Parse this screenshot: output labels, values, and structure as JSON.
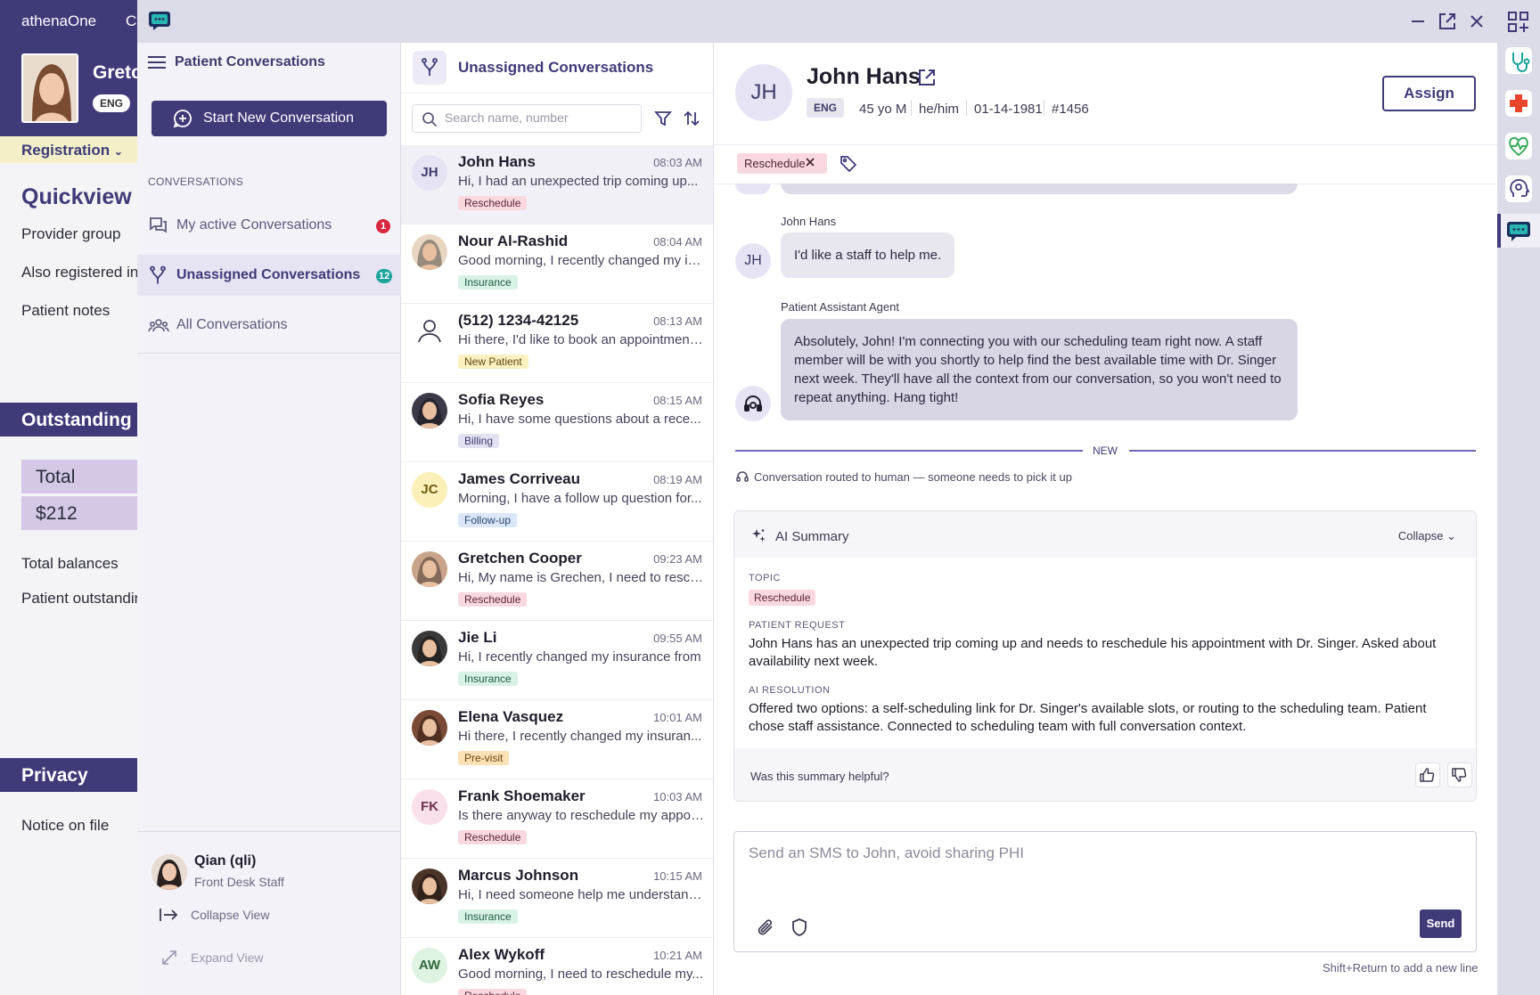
{
  "background": {
    "brand": "athenaOne",
    "tab_fragment": "C",
    "patient_name_fragment": "Gretc",
    "eng_badge": "ENG",
    "registration_label": "Registration",
    "quickview_heading": "Quickview",
    "provider_group": "Provider group",
    "also_registered": "Also registered in",
    "patient_notes": "Patient notes",
    "outstanding_band": "Outstanding B",
    "total_label": "Total",
    "total_value": "$212",
    "total_balances": "Total balances",
    "patient_outstanding": "Patient outstanding",
    "privacy_band": "Privacy",
    "notice_on_file": "Notice on file"
  },
  "nav": {
    "title": "Patient Conversations",
    "start_new": "Start New Conversation",
    "section_label": "CONVERSATIONS",
    "items": [
      {
        "label": "My active Conversations",
        "badge": "1",
        "badge_color": "#d7263d"
      },
      {
        "label": "Unassigned Conversations",
        "badge": "12",
        "badge_color": "#1ba39c"
      },
      {
        "label": "All Conversations",
        "badge": ""
      }
    ],
    "user": {
      "name": "Qian (qli)",
      "role": "Front Desk Staff"
    },
    "collapse_view": "Collapse View",
    "expand_view": "Expand View"
  },
  "list": {
    "title": "Unassigned Conversations",
    "search_placeholder": "Search name, number",
    "conversations": [
      {
        "initials": "JH",
        "name": "John Hans",
        "time": "08:03 AM",
        "preview": "Hi, I had an unexpected trip coming up...",
        "tag": "Reschedule",
        "tag_kind": "reschedule",
        "avatar": "initials",
        "avatar_bg": "#e6e4f4",
        "avatar_fg": "#3d3a6b"
      },
      {
        "initials": "",
        "name": "Nour Al-Rashid",
        "time": "08:04 AM",
        "preview": "Good morning, I recently changed my in...",
        "tag": "Insurance",
        "tag_kind": "insurance",
        "avatar": "photo",
        "avatar_bg": "#e8d6c0"
      },
      {
        "initials": "",
        "name": "(512) 1234-42125",
        "time": "08:13 AM",
        "preview": "Hi there, I'd like to book an appointment...",
        "tag": "New Patient",
        "tag_kind": "newpatient",
        "avatar": "person",
        "avatar_bg": "#ffffff"
      },
      {
        "initials": "",
        "name": "Sofia Reyes",
        "time": "08:15 AM",
        "preview": "Hi, I have some questions about a rece...",
        "tag": "Billing",
        "tag_kind": "billing",
        "avatar": "photo",
        "avatar_bg": "#3c3a48"
      },
      {
        "initials": "JC",
        "name": "James Corriveau",
        "time": "08:19 AM",
        "preview": "Morning, I have a follow up question for...",
        "tag": "Follow-up",
        "tag_kind": "followup",
        "avatar": "initials",
        "avatar_bg": "#fbf0b8",
        "avatar_fg": "#6b5a10"
      },
      {
        "initials": "",
        "name": "Gretchen Cooper",
        "time": "09:23 AM",
        "preview": "Hi, My name is Grechen, I need to resch...",
        "tag": "Reschedule",
        "tag_kind": "reschedule",
        "avatar": "photo",
        "avatar_bg": "#c9a48a"
      },
      {
        "initials": "",
        "name": "Jie Li",
        "time": "09:55 AM",
        "preview": "Hi, I recently changed my insurance from",
        "tag": "Insurance",
        "tag_kind": "insurance",
        "avatar": "photo",
        "avatar_bg": "#3a3a3a"
      },
      {
        "initials": "",
        "name": "Elena Vasquez",
        "time": "10:01 AM",
        "preview": "Hi there, I recently changed my insuran...",
        "tag": "Pre-visit",
        "tag_kind": "previsit",
        "avatar": "photo",
        "avatar_bg": "#7a4a36"
      },
      {
        "initials": "FK",
        "name": "Frank Shoemaker",
        "time": "10:03 AM",
        "preview": "Is there anyway to reschedule my appoi...",
        "tag": "Reschedule",
        "tag_kind": "reschedule",
        "avatar": "initials",
        "avatar_bg": "#f9e0ea",
        "avatar_fg": "#6b3050"
      },
      {
        "initials": "",
        "name": "Marcus Johnson",
        "time": "10:15 AM",
        "preview": "Hi, I need someone help me understand...",
        "tag": "Insurance",
        "tag_kind": "insurance",
        "avatar": "photo",
        "avatar_bg": "#4a3528"
      },
      {
        "initials": "AW",
        "name": "Alex Wykoff",
        "time": "10:21 AM",
        "preview": "Good morning, I need to reschedule my...",
        "tag": "Reschedule",
        "tag_kind": "reschedule",
        "avatar": "initials",
        "avatar_bg": "#dff3e3",
        "avatar_fg": "#2f6a3a"
      }
    ]
  },
  "tag_colors": {
    "reschedule": {
      "bg": "#f9d9df",
      "fg": "#5a2432"
    },
    "insurance": {
      "bg": "#d9f2e6",
      "fg": "#1f5a3e"
    },
    "newpatient": {
      "bg": "#fbf0c0",
      "fg": "#5e4a0c"
    },
    "billing": {
      "bg": "#e3e2f3",
      "fg": "#3d3a6b"
    },
    "followup": {
      "bg": "#dbe7f8",
      "fg": "#2a4773"
    },
    "previsit": {
      "bg": "#fbe1b6",
      "fg": "#6a4508"
    }
  },
  "detail": {
    "initials": "JH",
    "name": "John Hans",
    "eng": "ENG",
    "age": "45 yo M",
    "pronouns": "he/him",
    "dob": "01-14-1981",
    "mrn": "#1456",
    "assign": "Assign",
    "tag": "Reschedule",
    "messages": [
      {
        "sender": "John Hans",
        "initials": "JH",
        "text": "I'd like a staff to help me."
      },
      {
        "sender": "Patient Assistant Agent",
        "text": "Absolutely, John! I'm connecting you with our scheduling team right now. A staff member will be with you shortly to help find the best available time with Dr. Singer next week. They'll have all the context from our conversation, so you won't need to repeat anything. Hang tight!"
      }
    ],
    "new_label": "NEW",
    "routed": "Conversation routed to human — someone needs to pick it up",
    "summary": {
      "title": "AI Summary",
      "collapse": "Collapse",
      "topic_label": "TOPIC",
      "topic": "Reschedule",
      "request_label": "PATIENT REQUEST",
      "request": "John Hans has an unexpected trip coming up and needs to reschedule his appointment with Dr. Singer. Asked about availability next week.",
      "resolution_label": "AI RESOLUTION",
      "resolution": "Offered two options: a self-scheduling link for Dr. Singer's available slots, or routing to the scheduling team. Patient chose staff assistance. Connected to scheduling team with full conversation context.",
      "helpful_q": "Was this summary helpful?"
    },
    "composer_placeholder": "Send an SMS to John, avoid sharing PHI",
    "send": "Send",
    "hint": "Shift+Return to add a new line"
  }
}
